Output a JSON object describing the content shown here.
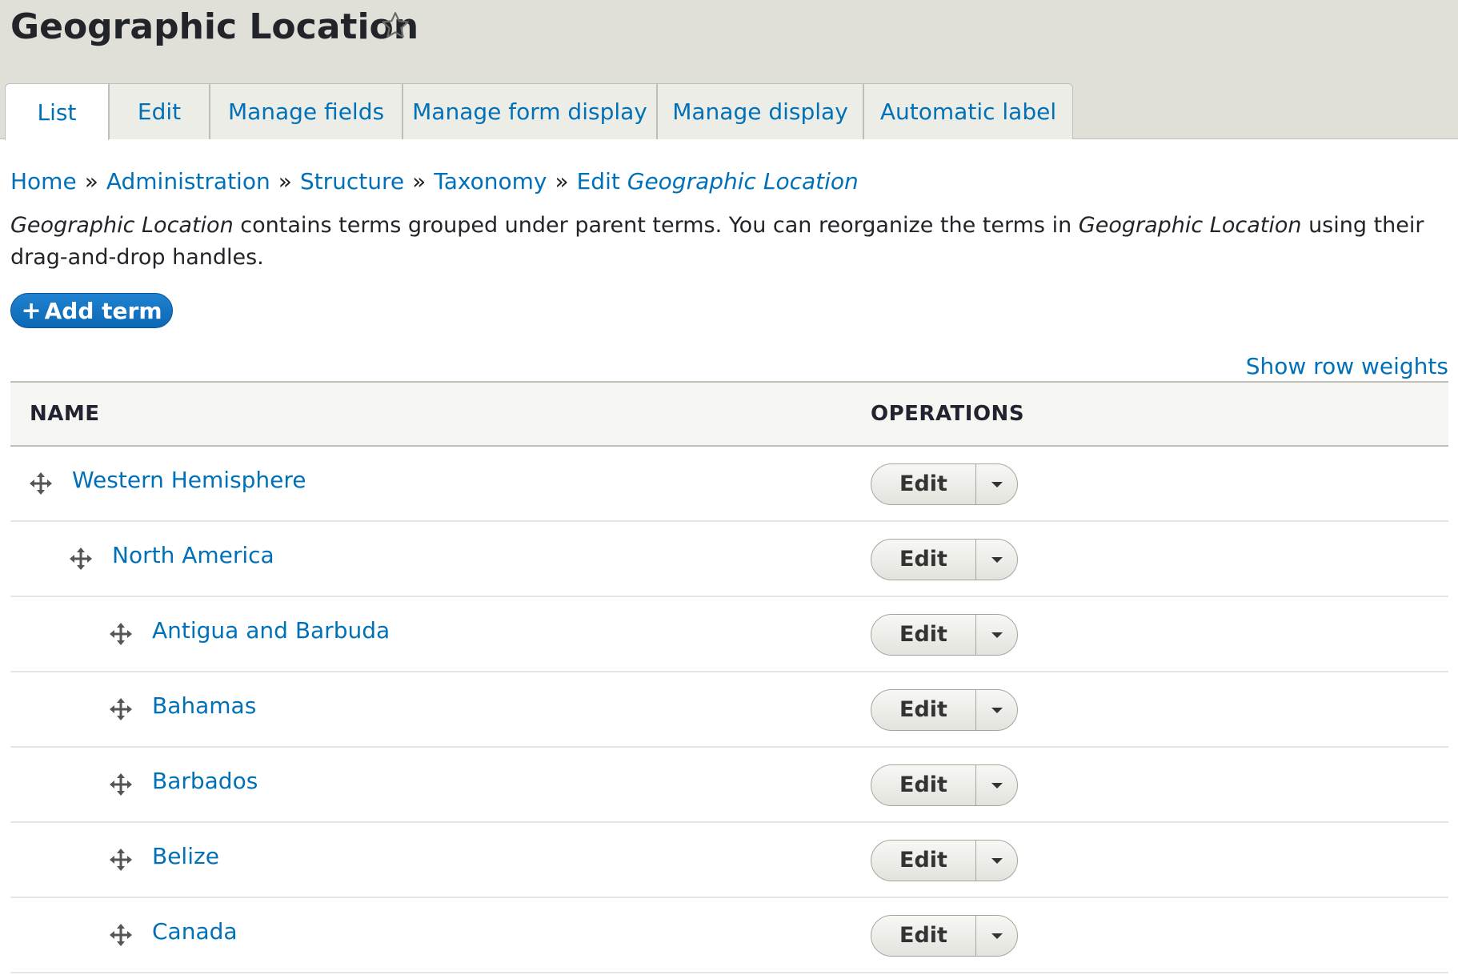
{
  "page": {
    "title": "Geographic Location",
    "star_icon": "star-outline-icon"
  },
  "tabs": [
    {
      "label": "List",
      "active": true
    },
    {
      "label": "Edit",
      "active": false
    },
    {
      "label": "Manage fields",
      "active": false
    },
    {
      "label": "Manage form display",
      "active": false
    },
    {
      "label": "Manage display",
      "active": false
    },
    {
      "label": "Automatic label",
      "active": false
    }
  ],
  "breadcrumb": {
    "items": [
      "Home",
      "Administration",
      "Structure",
      "Taxonomy"
    ],
    "last_prefix": "Edit",
    "last_emphasis": "Geographic Location",
    "separator": "»"
  },
  "description": {
    "part1_em": "Geographic Location",
    "part2": " contains terms grouped under parent terms. You can reorganize the terms in ",
    "part3_em": "Geographic Location",
    "part4": " using their drag-and-drop handles."
  },
  "actions": {
    "add_plus": "+",
    "add_label": "Add term",
    "show_row_weights": "Show row weights"
  },
  "table": {
    "headers": {
      "name": "NAME",
      "operations": "OPERATIONS"
    },
    "rows": [
      {
        "name": "Western Hemisphere",
        "depth": 0,
        "operation": "Edit"
      },
      {
        "name": "North America",
        "depth": 1,
        "operation": "Edit"
      },
      {
        "name": "Antigua and Barbuda",
        "depth": 2,
        "operation": "Edit"
      },
      {
        "name": "Bahamas",
        "depth": 2,
        "operation": "Edit"
      },
      {
        "name": "Barbados",
        "depth": 2,
        "operation": "Edit"
      },
      {
        "name": "Belize",
        "depth": 2,
        "operation": "Edit"
      },
      {
        "name": "Canada",
        "depth": 2,
        "operation": "Edit"
      }
    ]
  },
  "colors": {
    "link": "#0071b8",
    "header_bg": "#e0e0d8",
    "primary_button": "#0c68b5"
  }
}
